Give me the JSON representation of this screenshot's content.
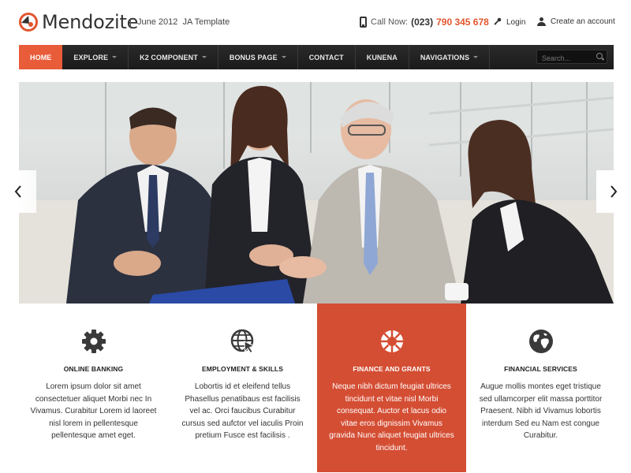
{
  "header": {
    "logo_text": "Mendozite",
    "tagline": "June 2012  JA Template",
    "call_label": "Call Now:",
    "call_area": "(023)",
    "call_number": "790 345 678",
    "login": "Login",
    "create_account": "Create an account"
  },
  "nav": {
    "items": [
      {
        "label": "HOME",
        "active": true
      },
      {
        "label": "EXPLORE",
        "dropdown": true
      },
      {
        "label": "K2 COMPONENT",
        "dropdown": true
      },
      {
        "label": "BONUS PAGE",
        "dropdown": true
      },
      {
        "label": "CONTACT"
      },
      {
        "label": "KUNENA"
      },
      {
        "label": "NAVIGATIONS",
        "dropdown": true
      }
    ],
    "search_placeholder": "Search..."
  },
  "colors": {
    "accent": "#e1562e",
    "nav_active": "#e85c3a",
    "highlight_panel": "#d44e34",
    "nav_bg": "#222222"
  },
  "features": [
    {
      "icon": "gear-icon",
      "title": "ONLINE BANKING",
      "text": "Lorem ipsum dolor sit amet consectetuer aliquet Morbi nec In Vivamus. Curabitur Lorem id laoreet nisl lorem in pellentesque pellentesque amet eget."
    },
    {
      "icon": "globe-cursor-icon",
      "title": "EMPLOYMENT & SKILLS",
      "text": "Lobortis id et eleifend tellus Phasellus penatibaus est facilisis vel ac. Orci faucibus Curabitur cursus sed aufctor vel iaculis Proin pretium Fusce est facilisis ."
    },
    {
      "icon": "lifebuoy-icon",
      "title": "FINANCE AND GRANTS",
      "text": "Neque nibh dictum feugiat ultrices tincidunt et vitae nisl Morbi consequat. Auctor et lacus odio vitae eros dignissim Vivamus gravida Nunc aliquet feugiat ultrices tincidunt."
    },
    {
      "icon": "world-icon",
      "title": "FINANCIAL SERVICES",
      "text": "Augue mollis montes eget tristique sed ullamcorper elit massa porttitor Praesent. Nibh id Vivamus lobortis interdum Sed eu Nam est congue Curabitur."
    }
  ]
}
